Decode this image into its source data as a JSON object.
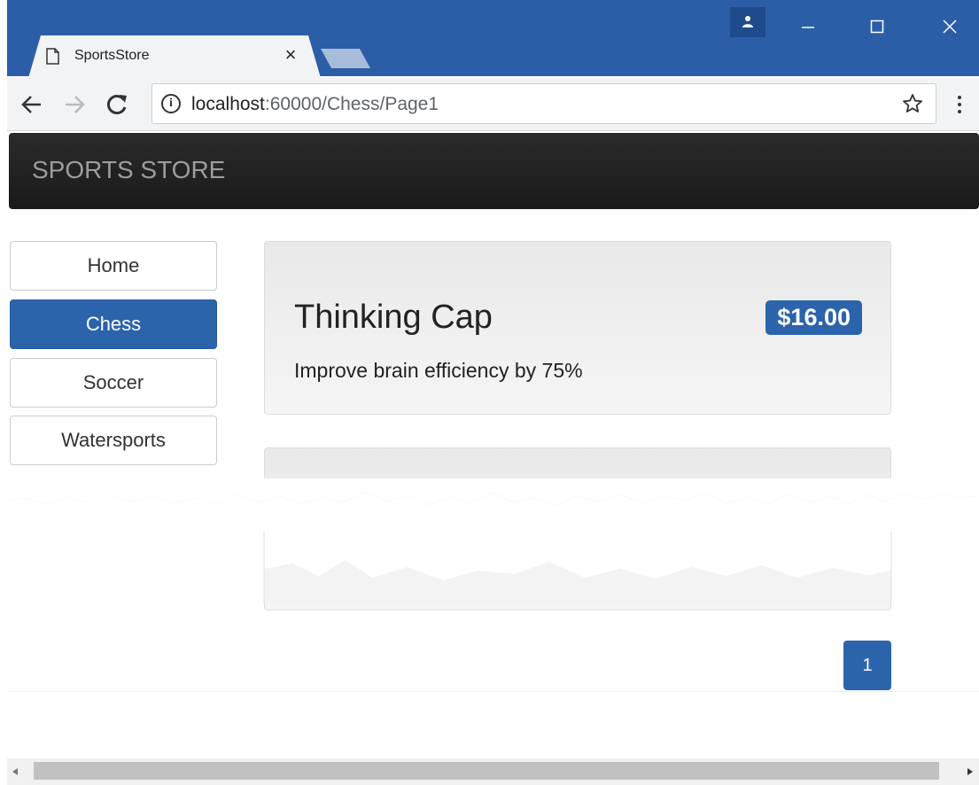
{
  "browser": {
    "tab_title": "SportsStore",
    "tab_close": "×",
    "url_host": "localhost",
    "url_path": ":60000/Chess/Page1",
    "info_glyph": "i"
  },
  "store": {
    "brand": "SPORTS STORE",
    "categories": [
      "Home",
      "Chess",
      "Soccer",
      "Watersports"
    ],
    "active_category": "Chess",
    "products": [
      {
        "name": "Thinking Cap",
        "price": "$16.00",
        "description": "Improve brain efficiency by 75%"
      }
    ],
    "pagination": {
      "pages": [
        "1"
      ],
      "current": "1"
    }
  },
  "colors": {
    "titlebar": "#2c5ea8",
    "accent": "#2c64ac",
    "navbar": "#1e1e1e"
  }
}
